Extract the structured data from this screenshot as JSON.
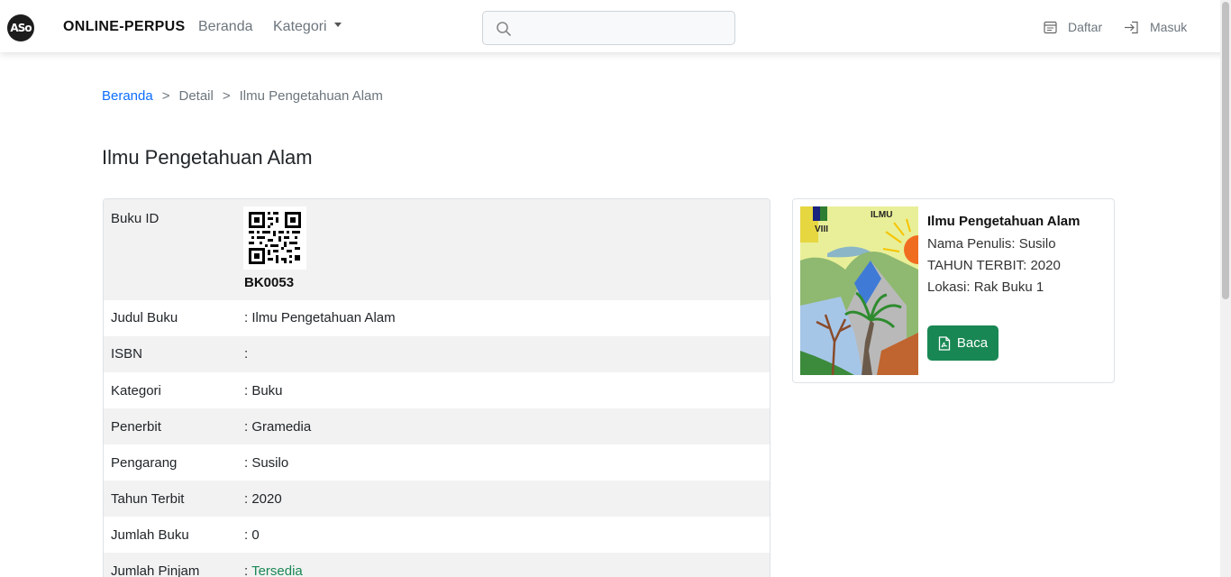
{
  "navbar": {
    "logo_text": "ASo",
    "brand": "ONLINE-PERPUS",
    "beranda": "Beranda",
    "kategori": "Kategori",
    "search_placeholder": "",
    "daftar": "Daftar",
    "masuk": "Masuk"
  },
  "breadcrumb": {
    "home": "Beranda",
    "sep": ">",
    "detail": "Detail",
    "current": "Ilmu Pengetahuan Alam"
  },
  "page_title": "Ilmu Pengetahuan Alam",
  "detail": {
    "buku_id_label": "Buku ID",
    "buku_id": "BK0053",
    "rows": [
      {
        "label": "Judul Buku",
        "value": ": Ilmu Pengetahuan Alam"
      },
      {
        "label": "ISBN",
        "value": ":"
      },
      {
        "label": "Kategori",
        "value": ": Buku"
      },
      {
        "label": "Penerbit",
        "value": ": Gramedia"
      },
      {
        "label": "Pengarang",
        "value": ": Susilo"
      },
      {
        "label": "Tahun Terbit",
        "value": ": 2020"
      },
      {
        "label": "Jumlah Buku",
        "value": ": 0"
      },
      {
        "label": "Jumlah Pinjam",
        "value_prefix": ": ",
        "value": "Tersedia"
      }
    ]
  },
  "side_card": {
    "title": "Ilmu Pengetahuan Alam",
    "penulis": "Nama Penulis: Susilo",
    "tahun": "TAHUN TERBIT: 2020",
    "lokasi": "Lokasi: Rak Buku 1",
    "button": "Baca",
    "cover_text_title": "ILMU",
    "cover_text_grade": "VIII"
  },
  "colors": {
    "link": "#0d6efd",
    "success": "#198754"
  }
}
